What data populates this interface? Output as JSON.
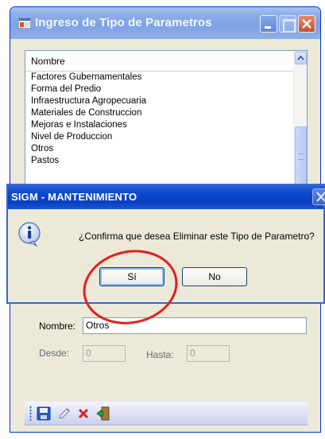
{
  "window": {
    "title": "Ingreso de Tipo de Parametros",
    "icon": "app-window-icon",
    "controls": [
      "minimize-icon",
      "maximize-icon",
      "close-icon"
    ]
  },
  "list": {
    "header": "Nombre",
    "items": [
      "Factores Gubernamentales",
      "Forma del Predio",
      "Infraestructura Agropecuaria",
      "Materiales de Construccion",
      "Mejoras e Instalaciones",
      "Nivel de Produccion",
      "Otros",
      "Pastos"
    ]
  },
  "form": {
    "nombre_label": "Nombre:",
    "nombre_value": "Otros",
    "desde_label": "Desde:",
    "desde_value": "0",
    "hasta_label": "Hasta:",
    "hasta_value": "0"
  },
  "toolbar": {
    "icons": [
      "save-icon",
      "edit-pencil-icon",
      "delete-x-icon",
      "exit-door-icon"
    ]
  },
  "dialog": {
    "title": "SIGM - MANTENIMIENTO",
    "message": "¿Confirma que desea Eliminar este Tipo de Parametro?",
    "yes_label": "Sí",
    "no_label": "No",
    "icon": "info-icon"
  },
  "colors": {
    "window_title_gradient": "#7fa2e4",
    "dialog_title": "#0a3fc0",
    "annotation": "#e21f1f",
    "window_bg": "#ece9d8"
  }
}
